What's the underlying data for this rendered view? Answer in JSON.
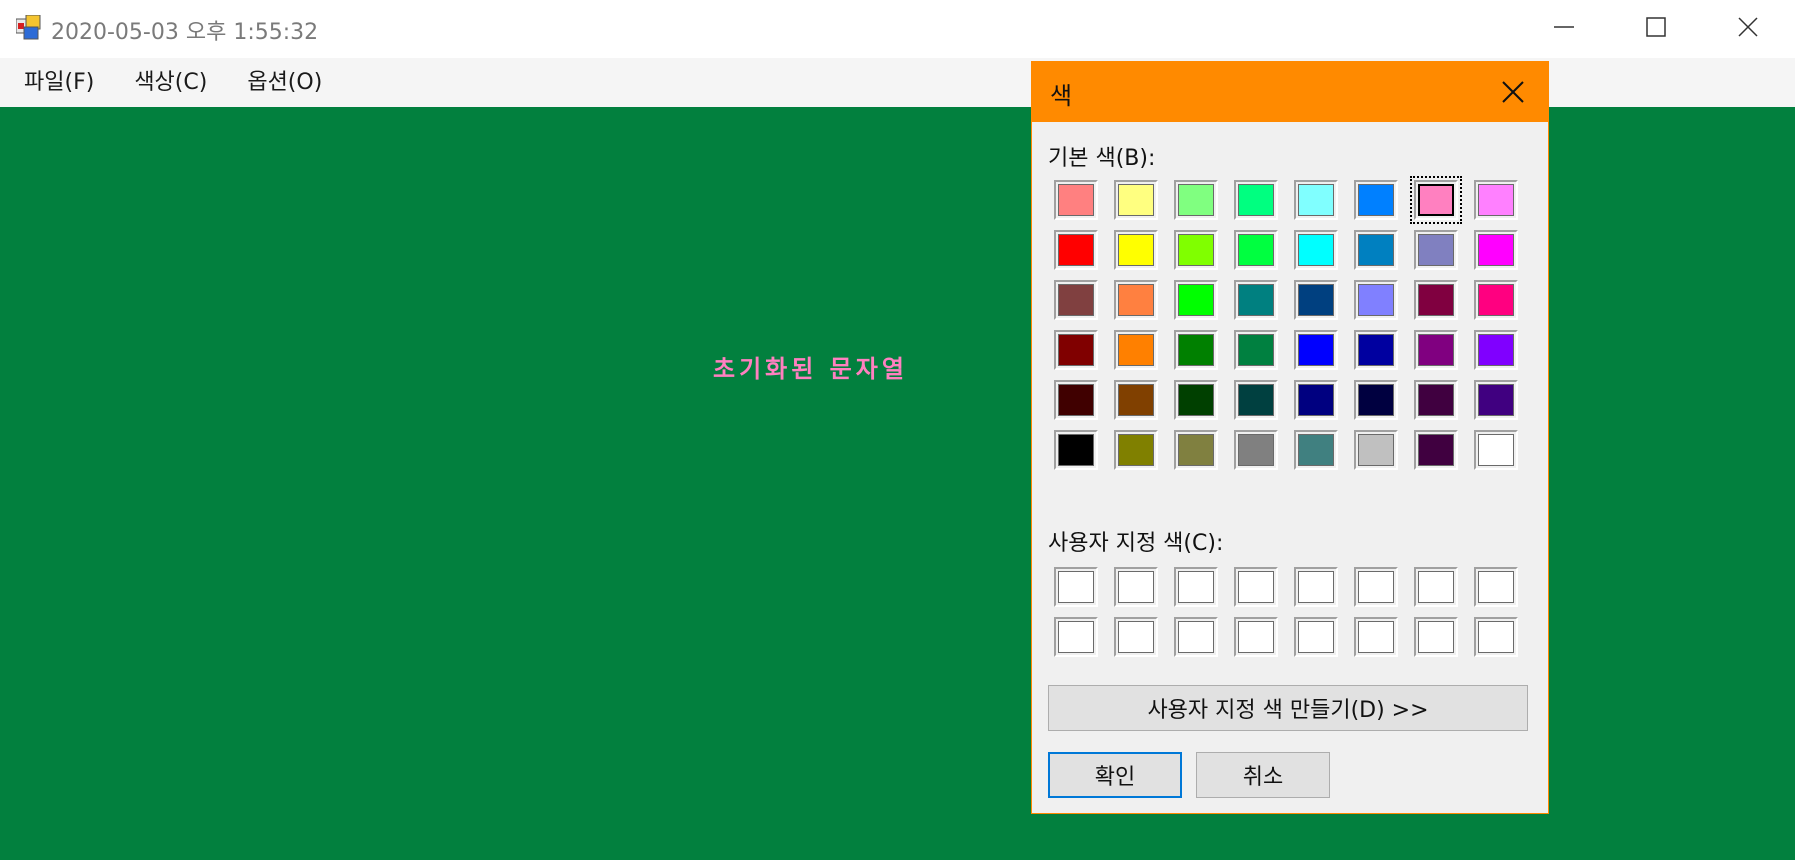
{
  "window": {
    "title": "2020-05-03 오후 1:55:32",
    "icon": "app-form-icon",
    "controls": [
      "minimize-icon",
      "maximize-icon",
      "close-icon"
    ]
  },
  "menu": {
    "items": [
      {
        "label": "파일(F)"
      },
      {
        "label": "색상(C)"
      },
      {
        "label": "옵션(O)"
      }
    ]
  },
  "client": {
    "background_color": "#02803e",
    "text": "초기화된 문자열",
    "text_color": "#ff80c0"
  },
  "dialog": {
    "title": "색",
    "title_bar_color": "#ff8a00",
    "basic_colors_label": "기본 색(B):",
    "custom_colors_label": "사용자 지정 색(C):",
    "define_custom_button": "사용자 지정 색 만들기(D) >>",
    "ok_button": "확인",
    "cancel_button": "취소",
    "selected_basic_index": 6,
    "basic_colors": [
      "#ff8080",
      "#ffff80",
      "#80ff80",
      "#00ff80",
      "#80ffff",
      "#0080ff",
      "#ff80c0",
      "#ff80ff",
      "#ff0000",
      "#ffff00",
      "#80ff00",
      "#00ff40",
      "#00ffff",
      "#0080c0",
      "#8080c0",
      "#ff00ff",
      "#804040",
      "#ff8040",
      "#00ff00",
      "#008080",
      "#004080",
      "#8080ff",
      "#800040",
      "#ff0080",
      "#800000",
      "#ff8000",
      "#008000",
      "#008040",
      "#0000ff",
      "#0000a0",
      "#800080",
      "#8000ff",
      "#400000",
      "#804000",
      "#004000",
      "#004040",
      "#000080",
      "#000040",
      "#400040",
      "#400080",
      "#000000",
      "#808000",
      "#808040",
      "#808080",
      "#408080",
      "#c0c0c0",
      "#400040",
      "#ffffff"
    ],
    "custom_colors": [
      "#ffffff",
      "#ffffff",
      "#ffffff",
      "#ffffff",
      "#ffffff",
      "#ffffff",
      "#ffffff",
      "#ffffff",
      "#ffffff",
      "#ffffff",
      "#ffffff",
      "#ffffff",
      "#ffffff",
      "#ffffff",
      "#ffffff",
      "#ffffff"
    ]
  }
}
